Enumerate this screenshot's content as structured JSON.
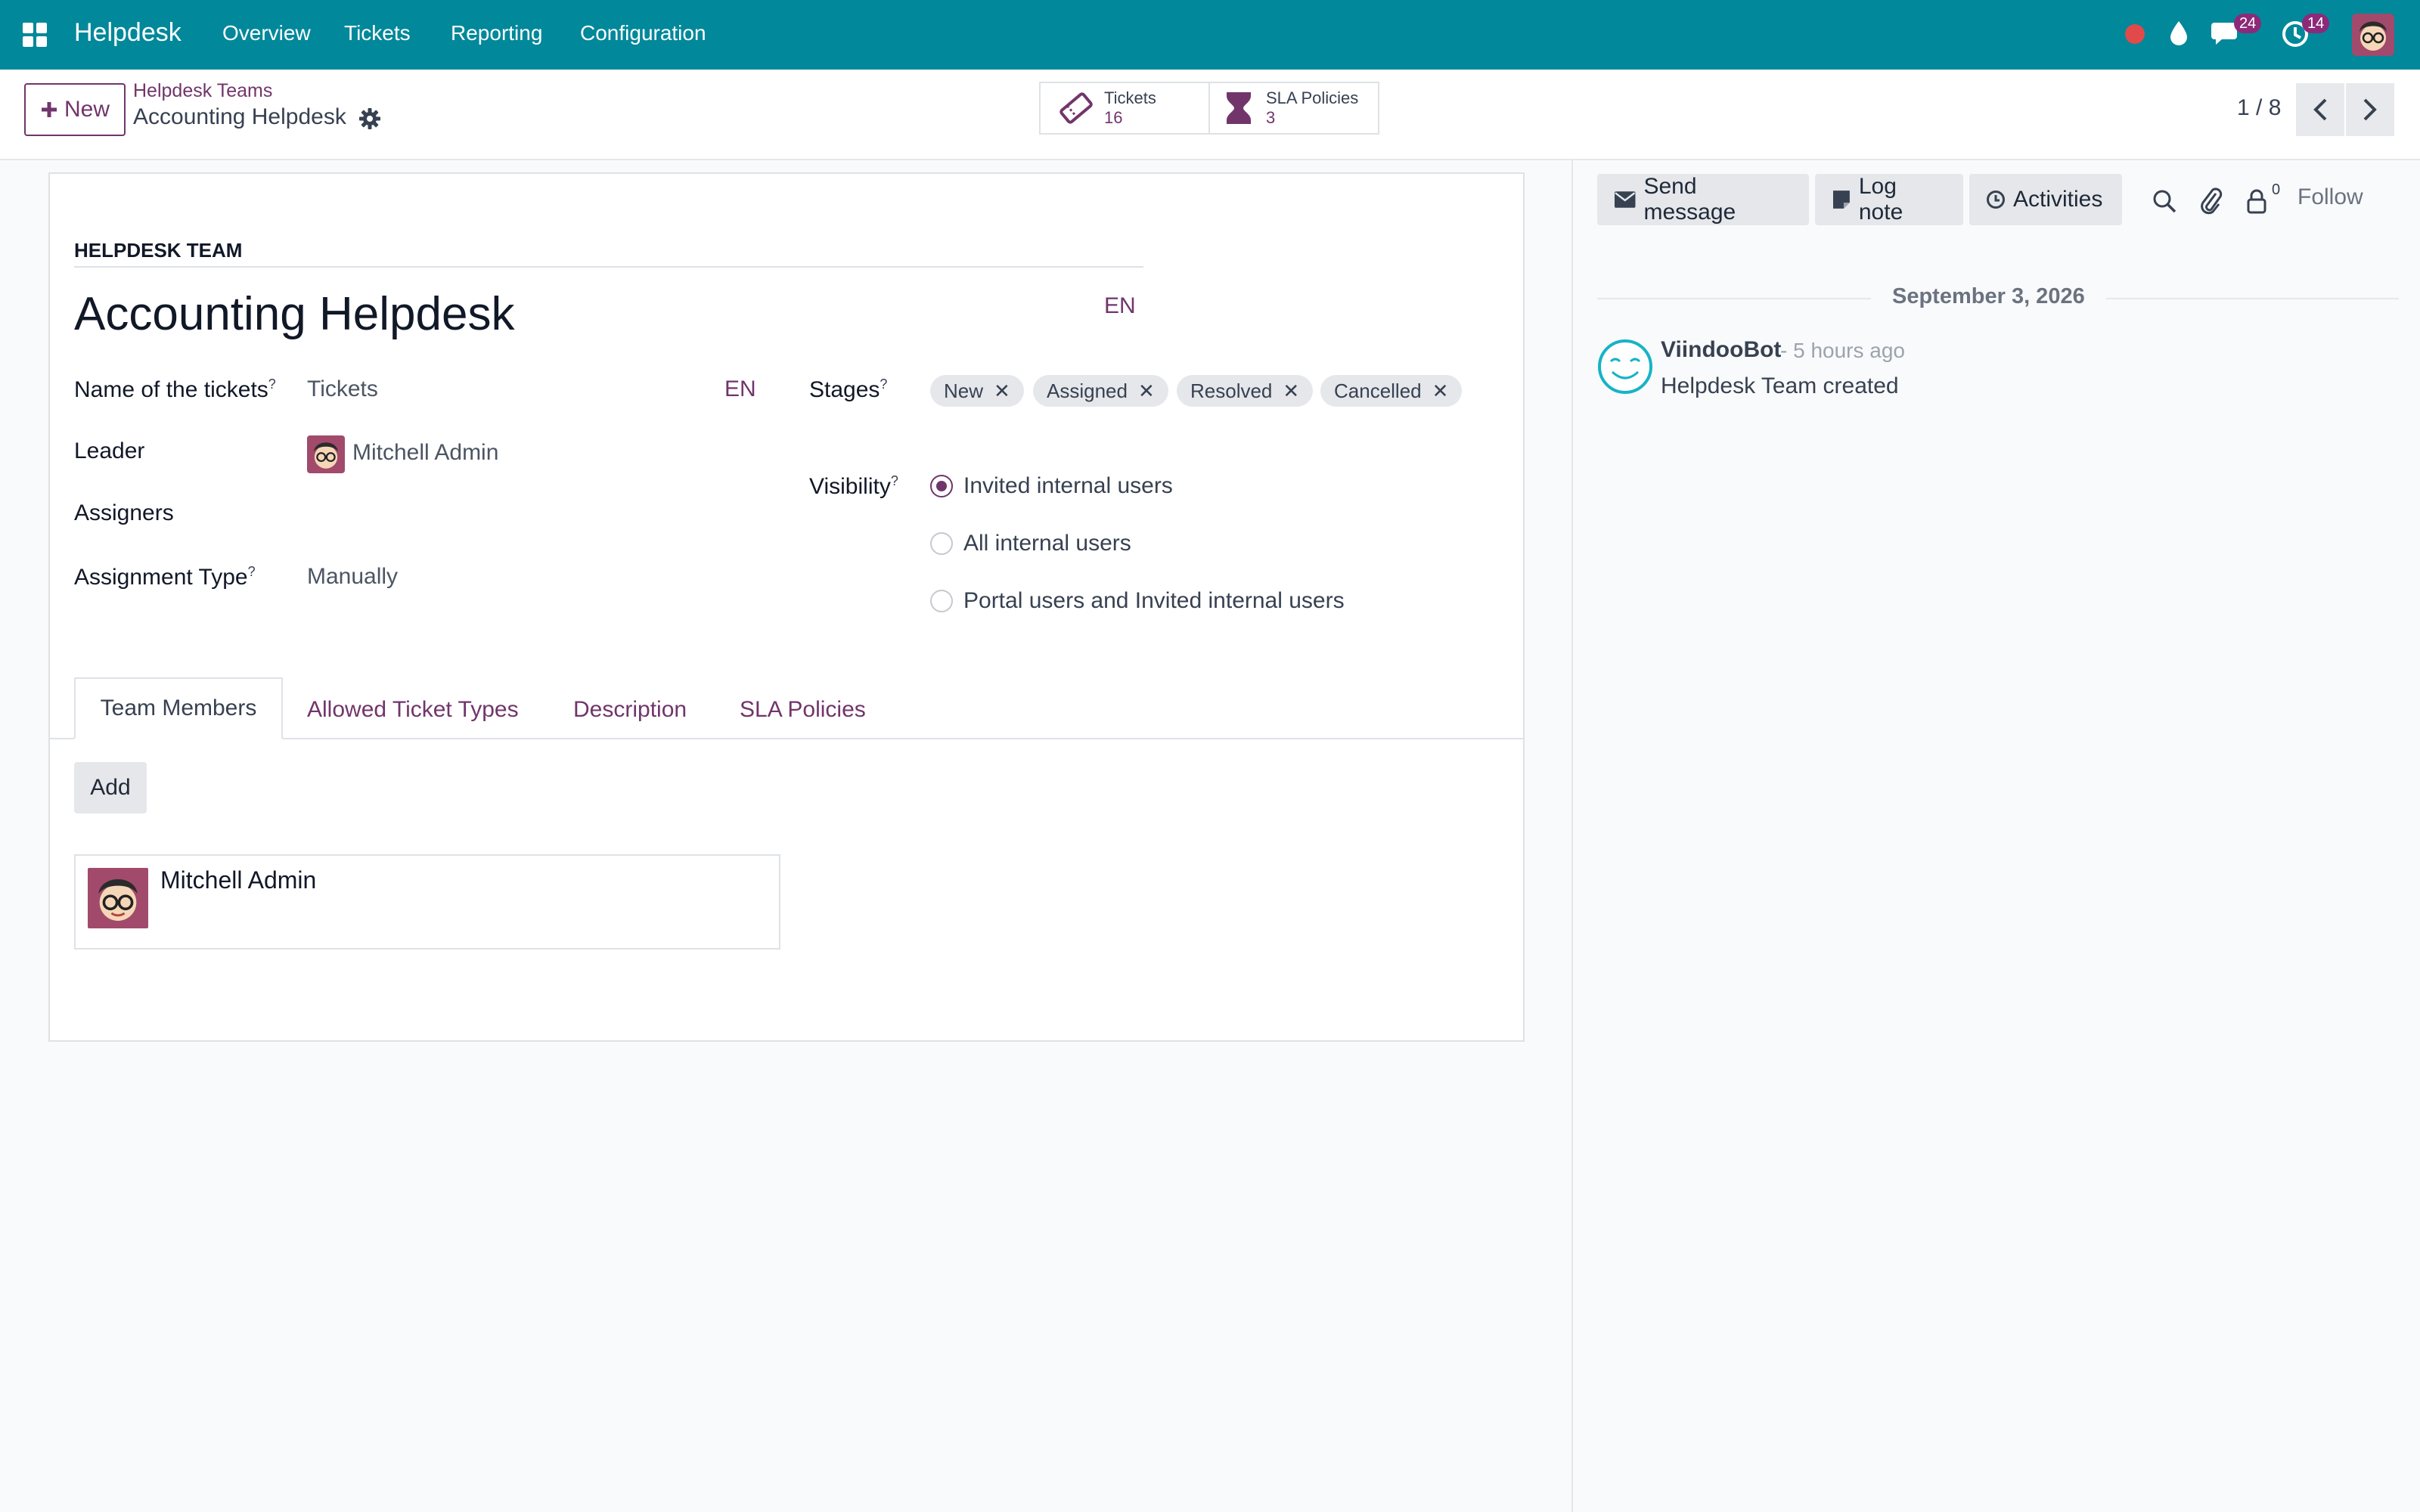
{
  "navbar": {
    "app_name": "Helpdesk",
    "menus": [
      "Overview",
      "Tickets",
      "Reporting",
      "Configuration"
    ],
    "messages_count": "24",
    "activities_count": "14",
    "bg_color": "#01889a"
  },
  "control": {
    "new_label": "New",
    "breadcrumb_parent": "Helpdesk Teams",
    "breadcrumb_current": "Accounting Helpdesk",
    "smart_buttons": [
      {
        "label": "Tickets",
        "value": "16",
        "icon": "ticket-icon"
      },
      {
        "label": "SLA Policies",
        "value": "3",
        "icon": "hourglass-icon"
      }
    ],
    "pager": "1 / 8"
  },
  "form": {
    "section_title": "HELPDESK TEAM",
    "team_name": "Accounting Helpdesk",
    "lang": "EN",
    "fields": {
      "ticket_name_label": "Name of the tickets",
      "ticket_name_value": "Tickets",
      "ticket_name_lang": "EN",
      "leader_label": "Leader",
      "leader_value": "Mitchell Admin",
      "assigners_label": "Assigners",
      "assignment_type_label": "Assignment Type",
      "assignment_type_value": "Manually",
      "stages_label": "Stages",
      "visibility_label": "Visibility",
      "help_mark": "?"
    },
    "stages": [
      "New",
      "Assigned",
      "Resolved",
      "Cancelled"
    ],
    "visibility_options": [
      {
        "label": "Invited internal users",
        "selected": true
      },
      {
        "label": "All internal users",
        "selected": false
      },
      {
        "label": "Portal users and Invited internal users",
        "selected": false
      }
    ],
    "tabs": [
      "Team Members",
      "Allowed Ticket Types",
      "Description",
      "SLA Policies"
    ],
    "active_tab": "Team Members",
    "add_label": "Add",
    "members": [
      {
        "name": "Mitchell Admin"
      }
    ]
  },
  "chatter": {
    "send_message": "Send message",
    "log_note": "Log note",
    "activities": "Activities",
    "followers_count": "0",
    "follow_label": "Follow",
    "date_separator": "September 3, 2026",
    "messages": [
      {
        "author": "ViindooBot",
        "time": "- 5 hours ago",
        "body": "Helpdesk Team created"
      }
    ]
  },
  "colors": {
    "brand": "#01889a",
    "accent": "#71356b",
    "status_dot": "#e04a4a"
  }
}
